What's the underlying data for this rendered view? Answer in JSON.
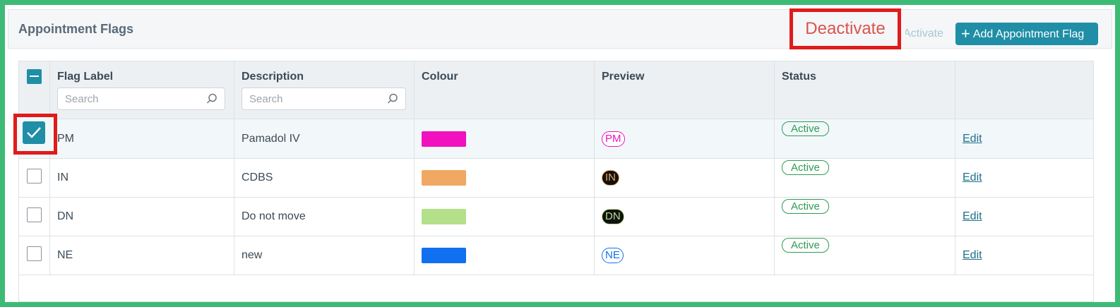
{
  "header": {
    "title": "Appointment Flags",
    "deactivate_label": "Deactivate",
    "activate_label": "Activate",
    "add_label": "Add Appointment Flag"
  },
  "table": {
    "columns": [
      "Flag Label",
      "Description",
      "Colour",
      "Preview",
      "Status"
    ],
    "search_placeholder": "Search",
    "edit_label": "Edit",
    "rows": [
      {
        "label": "PM",
        "description": "Pamadol IV",
        "colour": "#f012be",
        "preview": "PM",
        "preview_style": "outline",
        "status": "Active",
        "checked": true
      },
      {
        "label": "IN",
        "description": "CDBS",
        "colour": "#f0a862",
        "preview": "IN",
        "preview_style": "filled",
        "status": "Active",
        "checked": false
      },
      {
        "label": "DN",
        "description": "Do not move",
        "colour": "#b5e08a",
        "preview": "DN",
        "preview_style": "filled",
        "status": "Active",
        "checked": false
      },
      {
        "label": "NE",
        "description": "new",
        "colour": "#1070f0",
        "preview": "NE",
        "preview_style": "outline",
        "status": "Active",
        "checked": false
      }
    ]
  },
  "colors": {
    "accent": "#1f8ea6",
    "deactivate": "#d9534f",
    "status_active": "#2e9b52",
    "highlight": "#e01b1b"
  }
}
